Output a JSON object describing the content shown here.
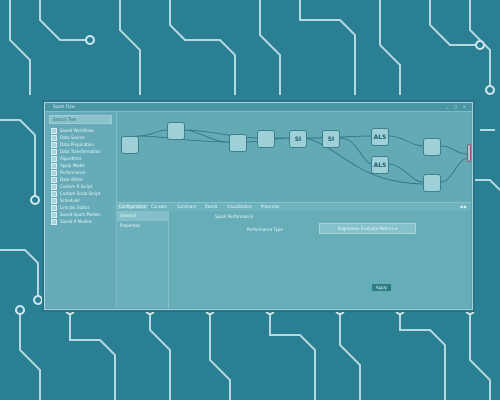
{
  "app": {
    "title": "Spark Flow",
    "window_controls": "_ □ ×"
  },
  "sidebar": {
    "search_placeholder": "Search Tree",
    "items": [
      {
        "label": "Saved Workflows"
      },
      {
        "label": "Data Source"
      },
      {
        "label": "Data Preparation"
      },
      {
        "label": "Data Transformation"
      },
      {
        "label": "Algorithms"
      },
      {
        "label": "Apply Model"
      },
      {
        "label": "Performance"
      },
      {
        "label": "Data Writer"
      },
      {
        "label": "Custom R Script"
      },
      {
        "label": "Custom Scala Script"
      },
      {
        "label": "Scheduler"
      },
      {
        "label": "Link Job Status"
      },
      {
        "label": "Saved Spark Models"
      },
      {
        "label": "Saved R Models"
      }
    ]
  },
  "canvas": {
    "nodes": [
      {
        "label": ""
      },
      {
        "label": ""
      },
      {
        "label": ""
      },
      {
        "label": ""
      },
      {
        "label": "SI"
      },
      {
        "label": "SI"
      },
      {
        "label": "ALS"
      },
      {
        "label": "ALS"
      },
      {
        "label": ""
      },
      {
        "label": ""
      },
      {
        "label": ""
      }
    ]
  },
  "tabs": [
    {
      "label": "Configuration"
    },
    {
      "label": "Console"
    },
    {
      "label": "Summary"
    },
    {
      "label": "Result"
    },
    {
      "label": "Visualization"
    },
    {
      "label": "Prescribe"
    }
  ],
  "tab_arrows": "◀ ▶",
  "left_panel": {
    "items": [
      {
        "label": "General"
      },
      {
        "label": "Properties"
      }
    ]
  },
  "content": {
    "section_title": "Spark Performance",
    "field_label": "Performance Type",
    "select_value": "Regression Evaluate Metrics ▾",
    "apply_label": "Apply"
  },
  "colors": {
    "accent": "#2b7f93",
    "window": "#5aa3b0",
    "node": "#9fd0d8",
    "output_node_border": "#a0506a",
    "apply_button": "#2f7d84"
  }
}
